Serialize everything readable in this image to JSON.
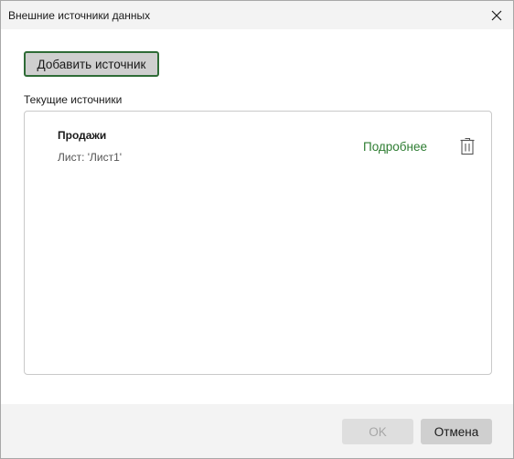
{
  "window": {
    "title": "Внешние источники данных",
    "close_icon": "close-icon"
  },
  "toolbar": {
    "add_label": "Добавить источник"
  },
  "sources": {
    "section_label": "Текущие источники",
    "items": [
      {
        "name": "Продажи",
        "sheet": "Лист: 'Лист1'",
        "details_label": "Подробнее",
        "delete_icon": "trash-icon"
      }
    ]
  },
  "footer": {
    "ok_label": "OK",
    "ok_enabled": false,
    "cancel_label": "Отмена"
  },
  "colors": {
    "accent_green": "#2e7d32",
    "button_border_green": "#2e6b36",
    "titlebar_bg": "#f3f3f3"
  }
}
